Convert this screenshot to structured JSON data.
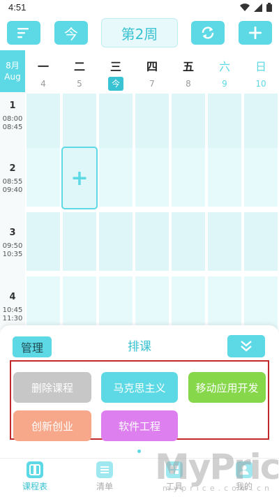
{
  "status_bar": {
    "time": "4:51"
  },
  "toolbar": {
    "menu_icon": "menu-lines-icon",
    "today_label": "今",
    "week_title": "第2周",
    "refresh_icon": "refresh-icon",
    "add_icon": "plus-icon"
  },
  "header": {
    "month_cn": "8月",
    "month_en": "Aug",
    "days": [
      {
        "weekday": "一",
        "date": "4"
      },
      {
        "weekday": "二",
        "date": "5"
      },
      {
        "weekday": "三",
        "date": "今"
      },
      {
        "weekday": "四",
        "date": "7"
      },
      {
        "weekday": "五",
        "date": "8"
      },
      {
        "weekday": "六",
        "date": "9"
      },
      {
        "weekday": "日",
        "date": "10"
      }
    ]
  },
  "periods": [
    {
      "num": "1",
      "start": "08:00",
      "end": "08:45"
    },
    {
      "num": "2",
      "start": "08:55",
      "end": "09:40"
    },
    {
      "num": "3",
      "start": "09:50",
      "end": "10:35"
    },
    {
      "num": "4",
      "start": "10:45",
      "end": "11:30"
    }
  ],
  "grid": {
    "add_symbol": "+"
  },
  "sheet": {
    "manage_label": "管理",
    "title": "排课",
    "collapse_icon": "double-chevron-down-icon",
    "courses": [
      {
        "label": "删除课程",
        "color": "#c7c7c7"
      },
      {
        "label": "马克思主义",
        "color": "#5dd9e6"
      },
      {
        "label": "移动应用开发",
        "color": "#86d84a"
      },
      {
        "label": "创新创业",
        "color": "#f7a88a"
      },
      {
        "label": "软件工程",
        "color": "#de7ff0"
      }
    ]
  },
  "nav": {
    "items": [
      {
        "label": "课程表",
        "icon": "timetable-icon"
      },
      {
        "label": "清单",
        "icon": "list-icon"
      },
      {
        "label": "工具",
        "icon": "tools-icon"
      },
      {
        "label": "我的",
        "icon": "profile-icon"
      }
    ]
  },
  "watermark": {
    "brand": "MyPrice",
    "url": "myprice.com.cn"
  },
  "colors": {
    "accent": "#5dd9e6",
    "accent_dark": "#39c2d2",
    "highlight_border": "#c22a2a"
  }
}
